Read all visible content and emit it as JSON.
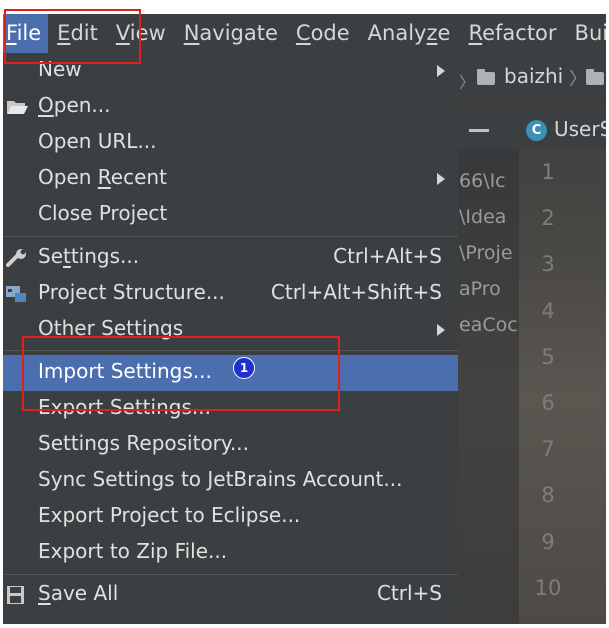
{
  "menubar": {
    "items": [
      {
        "label": "File",
        "underline": "F",
        "rest": "ile"
      },
      {
        "label": "Edit",
        "underline": "E",
        "rest": "dit"
      },
      {
        "label": "View",
        "underline": "V",
        "rest": "iew"
      },
      {
        "label": "Navigate",
        "underline": "N",
        "rest": "avigate"
      },
      {
        "label": "Code",
        "underline": "C",
        "rest": "ode"
      },
      {
        "label": "Analyze",
        "head": "Analy",
        "underline": "z",
        "rest": "e"
      },
      {
        "label": "Refactor",
        "underline": "R",
        "rest": "efactor"
      },
      {
        "label": "Bui",
        "underline": "",
        "rest": "Bui"
      }
    ]
  },
  "navbar": {
    "project": "baizhi",
    "separator": "〉"
  },
  "tab": {
    "class_letter": "C",
    "filename": "UserS"
  },
  "paths": [
    "66\\Ic",
    "\\Idea",
    "\\Proje",
    "aPro",
    "eaCoc"
  ],
  "line_numbers": [
    "1",
    "2",
    "3",
    "4",
    "5",
    "6",
    "7",
    "8",
    "9",
    "10"
  ],
  "file_menu": {
    "new": {
      "label": "New"
    },
    "open": {
      "label": "Open...",
      "underline": "O",
      "rest": "pen..."
    },
    "open_url": {
      "label": "Open URL..."
    },
    "open_recent": {
      "head": "Open ",
      "underline": "R",
      "rest": "ecent"
    },
    "close_project": {
      "label": "Close Project"
    },
    "settings": {
      "head": "Se",
      "underline": "t",
      "rest": "tings...",
      "shortcut": "Ctrl+Alt+S"
    },
    "project_structure": {
      "label": "Project Structure...",
      "shortcut": "Ctrl+Alt+Shift+S"
    },
    "other_settings": {
      "label": "Other Settings"
    },
    "import_settings": {
      "label": "Import Settings..."
    },
    "export_settings": {
      "label": "Export Settings..."
    },
    "settings_repository": {
      "label": "Settings Repository..."
    },
    "sync_settings": {
      "label": "Sync Settings to JetBrains Account..."
    },
    "export_eclipse": {
      "label": "Export Project to Eclipse..."
    },
    "export_zip": {
      "label": "Export to Zip File..."
    },
    "save_all": {
      "underline": "S",
      "rest": "ave All",
      "shortcut": "Ctrl+S"
    }
  },
  "annotation": {
    "badge": "1"
  },
  "colors": {
    "menu_bg": "#3c3f41",
    "selection": "#4b6eaf",
    "highlight_box": "#e0201c",
    "badge": "#1f2fd0"
  }
}
